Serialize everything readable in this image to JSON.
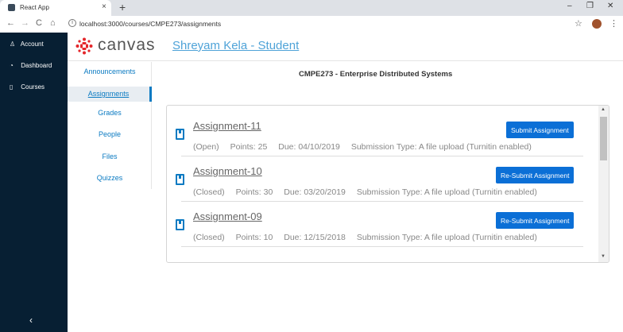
{
  "browser": {
    "tab_title": "React App",
    "url": "localhost:3000/courses/CMPE273/assignments",
    "tab_close": "×",
    "new_tab": "+",
    "minimize": "–",
    "restore": "❐",
    "close": "✕",
    "back": "←",
    "forward": "→",
    "reload": "C",
    "home": "⌂",
    "info": "i",
    "star": "☆",
    "menu": "⋮"
  },
  "global_nav": {
    "items": [
      {
        "label": "Account",
        "icon": "person-icon",
        "glyph": "♙"
      },
      {
        "label": "Dashboard",
        "icon": "dashboard-icon",
        "glyph": "◔"
      },
      {
        "label": "Courses",
        "icon": "book-icon",
        "glyph": "▯"
      }
    ],
    "collapse_glyph": "‹"
  },
  "header": {
    "logo_text": "canvas",
    "user_link": "Shreyam Kela - Student"
  },
  "course_nav": {
    "items": [
      "Announcements",
      "Assignments",
      "Grades",
      "People",
      "Files",
      "Quizzes"
    ],
    "active": "Assignments"
  },
  "course_title": "CMPE273 - Enterprise Distributed Systems",
  "assignments": [
    {
      "name": "Assignment-11",
      "status": "(Open)",
      "points": "Points: 25",
      "due": "Due: 04/10/2019",
      "submission": "Submission Type: A file upload (Turnitin enabled)",
      "button": "Submit Assignment"
    },
    {
      "name": "Assignment-10",
      "status": "(Closed)",
      "points": "Points: 30",
      "due": "Due: 03/20/2019",
      "submission": "Submission Type: A file upload (Turnitin enabled)",
      "button": "Re-Submit Assignment"
    },
    {
      "name": "Assignment-09",
      "status": "(Closed)",
      "points": "Points: 10",
      "due": "Due: 12/15/2018",
      "submission": "Submission Type: A file upload (Turnitin enabled)",
      "button": "Re-Submit Assignment"
    }
  ],
  "colors": {
    "global_nav_bg": "#071f33",
    "link_blue": "#0a7ac2",
    "button_blue": "#0b6fd6",
    "logo_red": "#e4262a"
  }
}
